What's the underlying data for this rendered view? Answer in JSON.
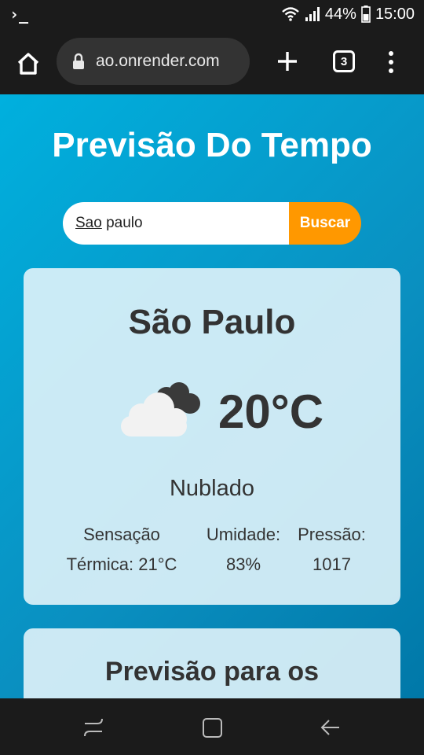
{
  "status_bar": {
    "terminal_glyph": "›_",
    "battery": "44%",
    "time": "15:00"
  },
  "browser": {
    "url": "ao.onrender.com",
    "tab_count": "3"
  },
  "page": {
    "title": "Previsão Do Tempo",
    "search": {
      "value_underlined": "Sao",
      "value_rest": " paulo",
      "button_label": "Buscar"
    },
    "weather": {
      "city": "São Paulo",
      "icon": "partly-cloudy-night-icon",
      "temperature": "20°C",
      "condition": "Nublado",
      "sensation_label": "Sensação",
      "sensation_value": "Térmica: 21°C",
      "humidity_label": "Umidade:",
      "humidity_value": "83%",
      "pressure_label": "Pressão:",
      "pressure_value": "1017"
    },
    "forecast": {
      "title": "Previsão para os"
    }
  },
  "colors": {
    "accent": "#ff9800",
    "background_gradient_start": "#00b0de",
    "background_gradient_end": "#0078a8",
    "card": "#e1f3fa"
  }
}
